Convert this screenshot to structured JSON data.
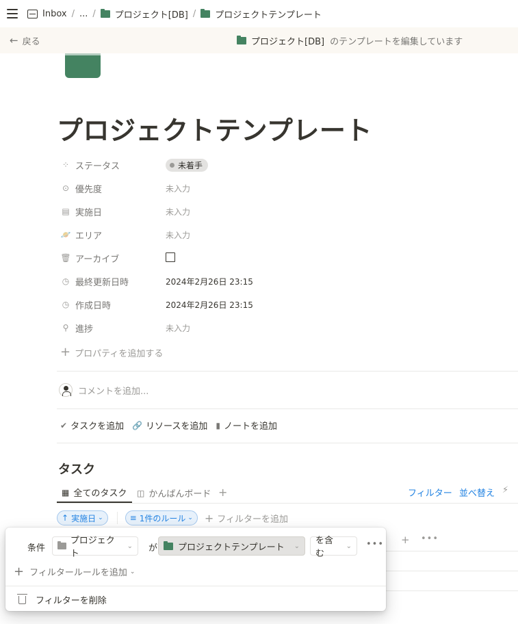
{
  "breadcrumb": {
    "inbox": "Inbox",
    "ellipsis": "...",
    "sep": "/",
    "db": "プロジェクト[DB]",
    "page": "プロジェクトテンプレート"
  },
  "editbar": {
    "back": "戻る",
    "db": "プロジェクト[DB]",
    "message": "のテンプレートを編集しています"
  },
  "page": {
    "title": "プロジェクトテンプレート"
  },
  "properties": [
    {
      "name": "ステータス",
      "icon": "status-icon",
      "value": "未着手"
    },
    {
      "name": "優先度",
      "icon": "priority-icon",
      "value": "未入力"
    },
    {
      "name": "実施日",
      "icon": "calendar-icon",
      "value": "未入力"
    },
    {
      "name": "エリア",
      "icon": "planet-icon",
      "value": "未入力"
    },
    {
      "name": "アーカイブ",
      "icon": "archive-icon",
      "value": ""
    },
    {
      "name": "最終更新日時",
      "icon": "clock-icon",
      "value": "2024年2月26日 23:15"
    },
    {
      "name": "作成日時",
      "icon": "clock-icon",
      "value": "2024年2月26日 23:15"
    },
    {
      "name": "進捗",
      "icon": "search-icon",
      "value": "未入力"
    }
  ],
  "add_property": "プロパティを追加する",
  "comment_placeholder": "コメントを追加...",
  "actions": {
    "task": "タスクを追加",
    "resource": "リソースを追加",
    "note": "ノートを追加"
  },
  "tasks": {
    "heading": "タスク",
    "tab_all": "全てのタスク",
    "tab_kanban": "かんばんボード",
    "filter": "フィルター",
    "sort": "並べ替え"
  },
  "filterbar": {
    "sort_chip": "実施日",
    "rule_chip": "1件のルール",
    "add_filter": "フィルターを追加"
  },
  "popup": {
    "condition": "条件",
    "property": "プロジェクト",
    "ga": "が",
    "value": "プロジェクトテンプレート",
    "operator": "を含む",
    "add_rule": "フィルタールールを追加",
    "delete": "フィルターを削除"
  },
  "colors": {
    "accent": "#2383e2",
    "folder_green": "#448361",
    "banner": "#fbf8f3"
  }
}
